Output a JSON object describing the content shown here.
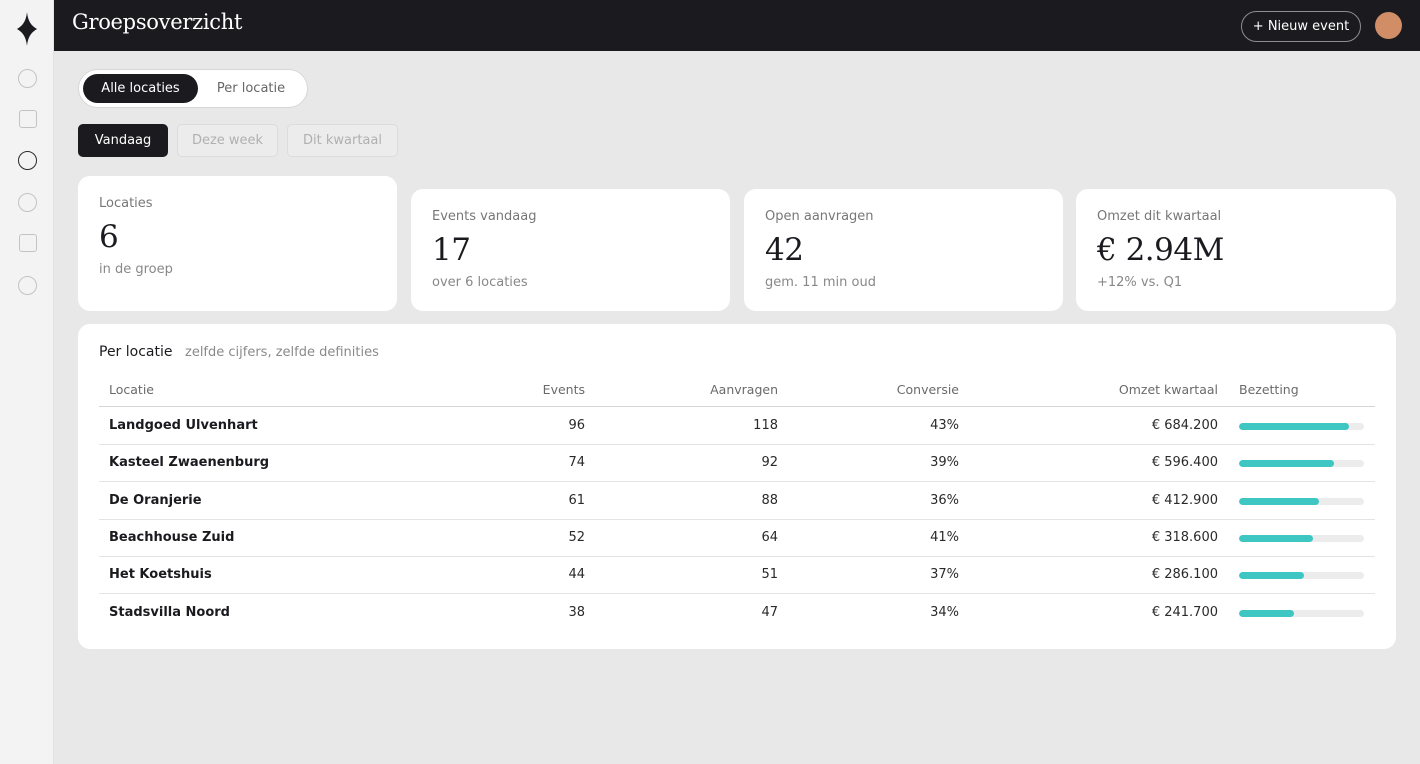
{
  "app": {
    "title": "Groepsoverzicht",
    "new_event_label": "+ Nieuw event"
  },
  "colors": {
    "accent": "#3ec6c3",
    "dark": "#1b1a1f",
    "avatar": "#d08d66"
  },
  "sidebar": {
    "items": [
      {
        "icon": "circle-icon"
      },
      {
        "icon": "square-icon"
      },
      {
        "icon": "circle-icon",
        "active": true
      },
      {
        "icon": "circle-icon"
      },
      {
        "icon": "square-icon"
      },
      {
        "icon": "circle-icon"
      }
    ]
  },
  "view_toggle": {
    "options": [
      "Alle locaties",
      "Per locatie"
    ],
    "selected": "Alle locaties"
  },
  "period": {
    "options": [
      "Vandaag",
      "Deze week",
      "Dit kwartaal"
    ],
    "selected": "Vandaag"
  },
  "kpis": [
    {
      "label": "Locaties",
      "value": "6",
      "sub": "in de groep"
    },
    {
      "label": "Events vandaag",
      "value": "17",
      "sub": "over 6 locaties"
    },
    {
      "label": "Open aanvragen",
      "value": "42",
      "sub": "gem. 11 min oud"
    },
    {
      "label": "Omzet dit kwartaal",
      "value": "€ 2.94M",
      "sub": "+12% vs. Q1"
    }
  ],
  "table": {
    "title": "Per locatie",
    "subtitle": "zelfde cijfers, zelfde definities",
    "headers": [
      "Locatie",
      "Events",
      "Aanvragen",
      "Conversie",
      "Omzet kwartaal",
      "Bezetting"
    ],
    "rows": [
      {
        "name": "Landgoed Ulvenhart",
        "events": "96",
        "aanvragen": "118",
        "conversie": "43%",
        "omzet": "€ 684.200",
        "bezetting": 0.88
      },
      {
        "name": "Kasteel Zwaenenburg",
        "events": "74",
        "aanvragen": "92",
        "conversie": "39%",
        "omzet": "€ 596.400",
        "bezetting": 0.76
      },
      {
        "name": "De Oranjerie",
        "events": "61",
        "aanvragen": "88",
        "conversie": "36%",
        "omzet": "€ 412.900",
        "bezetting": 0.64
      },
      {
        "name": "Beachhouse Zuid",
        "events": "52",
        "aanvragen": "64",
        "conversie": "41%",
        "omzet": "€ 318.600",
        "bezetting": 0.59
      },
      {
        "name": "Het Koetshuis",
        "events": "44",
        "aanvragen": "51",
        "conversie": "37%",
        "omzet": "€ 286.100",
        "bezetting": 0.52
      },
      {
        "name": "Stadsvilla Noord",
        "events": "38",
        "aanvragen": "47",
        "conversie": "34%",
        "omzet": "€ 241.700",
        "bezetting": 0.44
      }
    ]
  }
}
